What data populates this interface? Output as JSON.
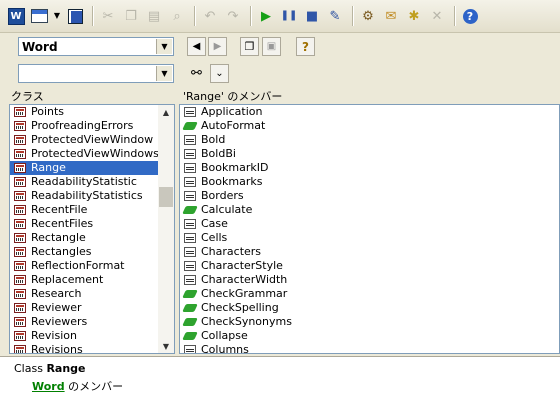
{
  "toolbar": {
    "icons": [
      "word-icon",
      "view-object-icon",
      "chevron-down-icon",
      "save-icon",
      "cut-icon",
      "copy-icon",
      "paste-icon",
      "find-icon",
      "undo-icon",
      "redo-icon",
      "run-icon",
      "pause-icon",
      "stop-icon",
      "design-mode-icon",
      "project-explorer-icon",
      "properties-icon",
      "object-browser-icon",
      "toolbox-icon",
      "help-icon"
    ]
  },
  "library_combo": {
    "value": "Word"
  },
  "search_combo": {
    "value": ""
  },
  "classes_header": "クラス",
  "members_header": "'Range' のメンバー",
  "classes": [
    {
      "label": "Points"
    },
    {
      "label": "ProofreadingErrors"
    },
    {
      "label": "ProtectedViewWindow"
    },
    {
      "label": "ProtectedViewWindows"
    },
    {
      "label": "Range",
      "selected": true
    },
    {
      "label": "ReadabilityStatistic"
    },
    {
      "label": "ReadabilityStatistics"
    },
    {
      "label": "RecentFile"
    },
    {
      "label": "RecentFiles"
    },
    {
      "label": "Rectangle"
    },
    {
      "label": "Rectangles"
    },
    {
      "label": "ReflectionFormat"
    },
    {
      "label": "Replacement"
    },
    {
      "label": "Research"
    },
    {
      "label": "Reviewer"
    },
    {
      "label": "Reviewers"
    },
    {
      "label": "Revision"
    },
    {
      "label": "Revisions"
    }
  ],
  "members": [
    {
      "label": "Application",
      "kind": "property"
    },
    {
      "label": "AutoFormat",
      "kind": "method"
    },
    {
      "label": "Bold",
      "kind": "property"
    },
    {
      "label": "BoldBi",
      "kind": "property"
    },
    {
      "label": "BookmarkID",
      "kind": "property"
    },
    {
      "label": "Bookmarks",
      "kind": "property"
    },
    {
      "label": "Borders",
      "kind": "property"
    },
    {
      "label": "Calculate",
      "kind": "method"
    },
    {
      "label": "Case",
      "kind": "property"
    },
    {
      "label": "Cells",
      "kind": "property"
    },
    {
      "label": "Characters",
      "kind": "property"
    },
    {
      "label": "CharacterStyle",
      "kind": "property"
    },
    {
      "label": "CharacterWidth",
      "kind": "property"
    },
    {
      "label": "CheckGrammar",
      "kind": "method"
    },
    {
      "label": "CheckSpelling",
      "kind": "method"
    },
    {
      "label": "CheckSynonyms",
      "kind": "method"
    },
    {
      "label": "Collapse",
      "kind": "method"
    },
    {
      "label": "Columns",
      "kind": "property"
    }
  ],
  "footer": {
    "prefix": "Class",
    "class_name": "Range",
    "library_link": "Word",
    "suffix": "のメンバー"
  }
}
